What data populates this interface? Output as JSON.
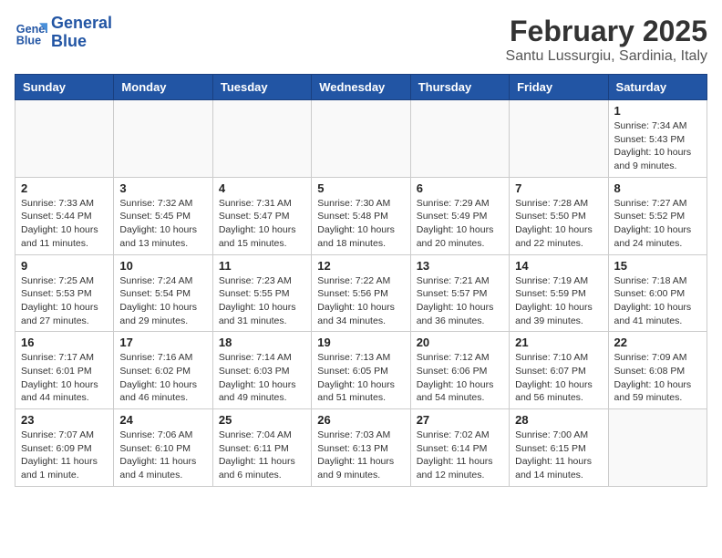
{
  "header": {
    "logo_line1": "General",
    "logo_line2": "Blue",
    "month_title": "February 2025",
    "subtitle": "Santu Lussurgiu, Sardinia, Italy"
  },
  "days_of_week": [
    "Sunday",
    "Monday",
    "Tuesday",
    "Wednesday",
    "Thursday",
    "Friday",
    "Saturday"
  ],
  "weeks": [
    [
      {
        "day": "",
        "info": ""
      },
      {
        "day": "",
        "info": ""
      },
      {
        "day": "",
        "info": ""
      },
      {
        "day": "",
        "info": ""
      },
      {
        "day": "",
        "info": ""
      },
      {
        "day": "",
        "info": ""
      },
      {
        "day": "1",
        "info": "Sunrise: 7:34 AM\nSunset: 5:43 PM\nDaylight: 10 hours and 9 minutes."
      }
    ],
    [
      {
        "day": "2",
        "info": "Sunrise: 7:33 AM\nSunset: 5:44 PM\nDaylight: 10 hours and 11 minutes."
      },
      {
        "day": "3",
        "info": "Sunrise: 7:32 AM\nSunset: 5:45 PM\nDaylight: 10 hours and 13 minutes."
      },
      {
        "day": "4",
        "info": "Sunrise: 7:31 AM\nSunset: 5:47 PM\nDaylight: 10 hours and 15 minutes."
      },
      {
        "day": "5",
        "info": "Sunrise: 7:30 AM\nSunset: 5:48 PM\nDaylight: 10 hours and 18 minutes."
      },
      {
        "day": "6",
        "info": "Sunrise: 7:29 AM\nSunset: 5:49 PM\nDaylight: 10 hours and 20 minutes."
      },
      {
        "day": "7",
        "info": "Sunrise: 7:28 AM\nSunset: 5:50 PM\nDaylight: 10 hours and 22 minutes."
      },
      {
        "day": "8",
        "info": "Sunrise: 7:27 AM\nSunset: 5:52 PM\nDaylight: 10 hours and 24 minutes."
      }
    ],
    [
      {
        "day": "9",
        "info": "Sunrise: 7:25 AM\nSunset: 5:53 PM\nDaylight: 10 hours and 27 minutes."
      },
      {
        "day": "10",
        "info": "Sunrise: 7:24 AM\nSunset: 5:54 PM\nDaylight: 10 hours and 29 minutes."
      },
      {
        "day": "11",
        "info": "Sunrise: 7:23 AM\nSunset: 5:55 PM\nDaylight: 10 hours and 31 minutes."
      },
      {
        "day": "12",
        "info": "Sunrise: 7:22 AM\nSunset: 5:56 PM\nDaylight: 10 hours and 34 minutes."
      },
      {
        "day": "13",
        "info": "Sunrise: 7:21 AM\nSunset: 5:57 PM\nDaylight: 10 hours and 36 minutes."
      },
      {
        "day": "14",
        "info": "Sunrise: 7:19 AM\nSunset: 5:59 PM\nDaylight: 10 hours and 39 minutes."
      },
      {
        "day": "15",
        "info": "Sunrise: 7:18 AM\nSunset: 6:00 PM\nDaylight: 10 hours and 41 minutes."
      }
    ],
    [
      {
        "day": "16",
        "info": "Sunrise: 7:17 AM\nSunset: 6:01 PM\nDaylight: 10 hours and 44 minutes."
      },
      {
        "day": "17",
        "info": "Sunrise: 7:16 AM\nSunset: 6:02 PM\nDaylight: 10 hours and 46 minutes."
      },
      {
        "day": "18",
        "info": "Sunrise: 7:14 AM\nSunset: 6:03 PM\nDaylight: 10 hours and 49 minutes."
      },
      {
        "day": "19",
        "info": "Sunrise: 7:13 AM\nSunset: 6:05 PM\nDaylight: 10 hours and 51 minutes."
      },
      {
        "day": "20",
        "info": "Sunrise: 7:12 AM\nSunset: 6:06 PM\nDaylight: 10 hours and 54 minutes."
      },
      {
        "day": "21",
        "info": "Sunrise: 7:10 AM\nSunset: 6:07 PM\nDaylight: 10 hours and 56 minutes."
      },
      {
        "day": "22",
        "info": "Sunrise: 7:09 AM\nSunset: 6:08 PM\nDaylight: 10 hours and 59 minutes."
      }
    ],
    [
      {
        "day": "23",
        "info": "Sunrise: 7:07 AM\nSunset: 6:09 PM\nDaylight: 11 hours and 1 minute."
      },
      {
        "day": "24",
        "info": "Sunrise: 7:06 AM\nSunset: 6:10 PM\nDaylight: 11 hours and 4 minutes."
      },
      {
        "day": "25",
        "info": "Sunrise: 7:04 AM\nSunset: 6:11 PM\nDaylight: 11 hours and 6 minutes."
      },
      {
        "day": "26",
        "info": "Sunrise: 7:03 AM\nSunset: 6:13 PM\nDaylight: 11 hours and 9 minutes."
      },
      {
        "day": "27",
        "info": "Sunrise: 7:02 AM\nSunset: 6:14 PM\nDaylight: 11 hours and 12 minutes."
      },
      {
        "day": "28",
        "info": "Sunrise: 7:00 AM\nSunset: 6:15 PM\nDaylight: 11 hours and 14 minutes."
      },
      {
        "day": "",
        "info": ""
      }
    ]
  ]
}
